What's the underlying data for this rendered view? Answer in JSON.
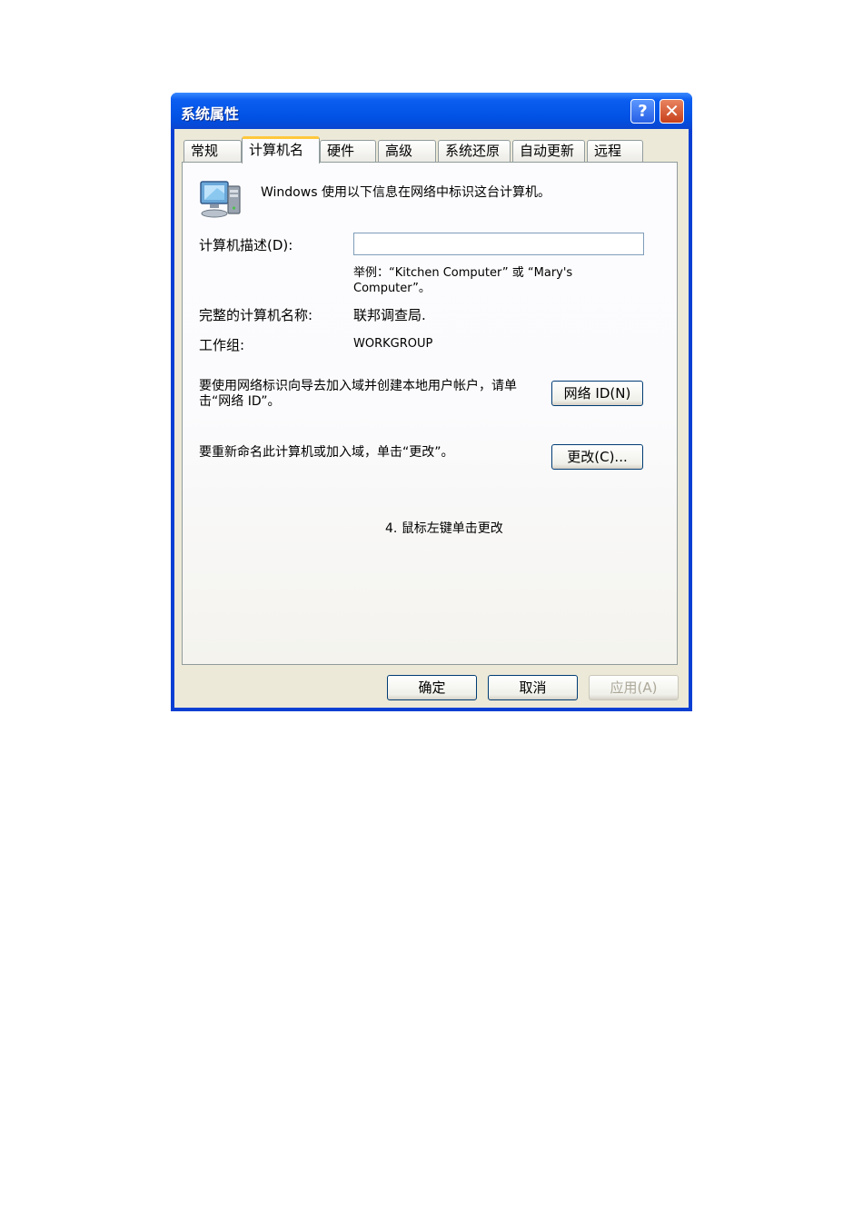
{
  "window": {
    "title": "系统属性",
    "help_icon": "?",
    "close_icon": "✕"
  },
  "tabs": [
    {
      "label": "常规",
      "active": false
    },
    {
      "label": "计算机名",
      "active": true
    },
    {
      "label": "硬件",
      "active": false
    },
    {
      "label": "高级",
      "active": false
    },
    {
      "label": "系统还原",
      "active": false
    },
    {
      "label": "自动更新",
      "active": false
    },
    {
      "label": "远程",
      "active": false
    }
  ],
  "panel": {
    "icon": "computer-icon",
    "intro": "Windows 使用以下信息在网络中标识这台计算机。",
    "description_label": "计算机描述(D):",
    "description_value": "",
    "example": "举例：“Kitchen Computer” 或 “Mary's Computer”。",
    "full_name_label": "完整的计算机名称:",
    "full_name_value": "联邦调查局.",
    "workgroup_label": "工作组:",
    "workgroup_value": "WORKGROUP",
    "network_id_text": "要使用网络标识向导去加入域并创建本地用户帐户，请单击“网络 ID”。",
    "network_id_button": "网络 ID(N)",
    "rename_text": "要重新命名此计算机或加入域，单击“更改”。",
    "change_button": "更改(C)...",
    "caption": "4. 鼠标左键单击更改"
  },
  "footer": {
    "ok_button": "确定",
    "cancel_button": "取消",
    "apply_button": "应用(A)"
  }
}
